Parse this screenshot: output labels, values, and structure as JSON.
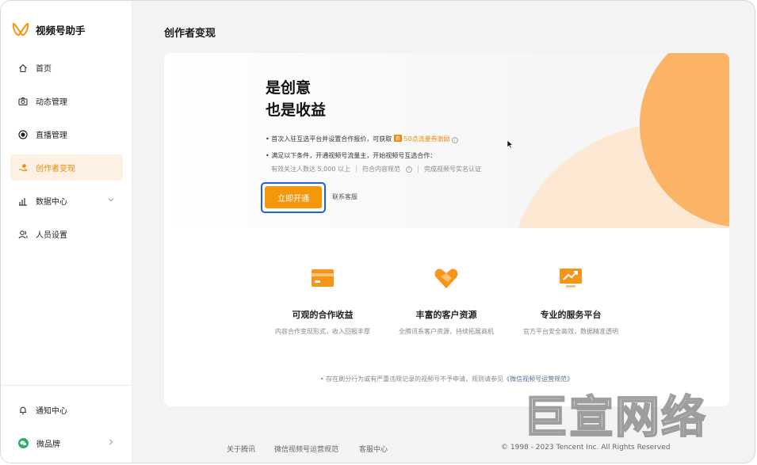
{
  "brand": {
    "name": "视频号助手",
    "logo": "wechat-channels-logo",
    "accent": "#f5970d"
  },
  "sidebar": {
    "items": [
      {
        "label": "首页",
        "icon": "home-icon"
      },
      {
        "label": "动态管理",
        "icon": "camera-icon"
      },
      {
        "label": "直播管理",
        "icon": "live-icon"
      },
      {
        "label": "创作者变现",
        "icon": "monetize-icon",
        "active": true
      },
      {
        "label": "数据中心",
        "icon": "chart-icon",
        "expandable": true
      },
      {
        "label": "人员设置",
        "icon": "people-icon"
      }
    ],
    "bottom": [
      {
        "label": "通知中心",
        "icon": "bell-icon"
      },
      {
        "label": "微品牌",
        "icon": "wechat-icon"
      }
    ]
  },
  "page": {
    "title": "创作者变现"
  },
  "hero": {
    "title_line1": "是创意",
    "title_line2": "也是收益",
    "bullet1_prefix": "• 首次入驻互选平台并设置合作报价，可获取",
    "bullet1_tag": "券",
    "bullet1_highlight": "50点流量券激励",
    "bullet2": "• 满足以下条件，开通视频号流量主，开始视频号互选合作：",
    "conditions": [
      "有效关注人数达 5,000 以上",
      "符合内容规范",
      "完成视频号实名认证"
    ],
    "primary_button": "立即开通",
    "service_link": "联系客服"
  },
  "features": [
    {
      "title": "可观的合作收益",
      "desc": "内容合作变现形式，收入回报丰厚",
      "icon": "card-icon"
    },
    {
      "title": "丰富的客户资源",
      "desc": "全腾讯系客户资源，持续拓展商机",
      "icon": "handshake-heart-icon"
    },
    {
      "title": "专业的服务平台",
      "desc": "官方平台安全高效，数据精准透明",
      "icon": "monitor-trend-icon"
    }
  ],
  "notice": {
    "text": "• 存在刷分行为或有严重违规记录的视频号不予申请，规则请参见",
    "link": "《微信视频号运营规范》"
  },
  "footer": {
    "links": [
      "关于腾讯",
      "微信视频号运营规范",
      "客服中心"
    ],
    "copyright": "© 1998 - 2023 Tencent Inc. All Rights Reserved"
  },
  "watermark": "巨宣网络"
}
